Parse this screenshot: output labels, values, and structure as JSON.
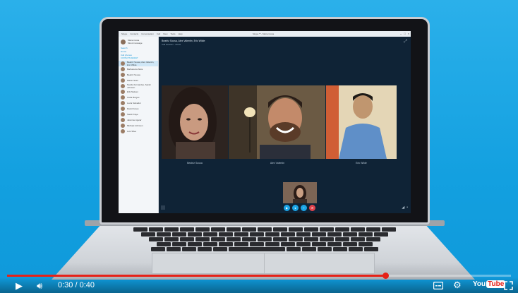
{
  "window": {
    "title": "Skype™ - Maria Costa",
    "menu": [
      "Skype",
      "Contacts",
      "Conversation",
      "Call",
      "View",
      "Tools",
      "Help"
    ]
  },
  "sidebar": {
    "profile_name": "Maria Costa",
    "profile_status": "Mood message",
    "links": [
      "Search",
      "Home",
      "Call phones"
    ],
    "section_recent": "CONTACTS",
    "section_recent_alt": "RECENT",
    "active_item": "Beatriz Sousa, Alex Valentin, Eric Wilde",
    "contacts": [
      "Barbara da Silva",
      "Beatriz Sousa",
      "Martin Stolz",
      "Nanda Fernandes, Sarah Johnson",
      "Erik Nielsen",
      "Carla Borges",
      "Lucia Salvador",
      "David Jones",
      "Sarah Kaye",
      "Jasmine Aguiar",
      "Michael Johnson",
      "Luis Silva"
    ]
  },
  "call": {
    "title": "Beatriz Sousa, Alex Valentin, Eric Wilde",
    "subtitle": "Call duration · 00:00",
    "participants": [
      {
        "name": "Beatriz Sousa"
      },
      {
        "name": "Alex Valentin"
      },
      {
        "name": "Eric Wilde"
      }
    ]
  },
  "player": {
    "time": "0:30 / 0:40",
    "progress_fraction": 0.75,
    "logo_you": "You",
    "logo_tube": "Tube",
    "progress_color": "#e62117"
  },
  "icons": [
    "play-icon",
    "volume-icon",
    "subtitles-icon",
    "settings-icon",
    "fullscreen-icon",
    "expand-icon"
  ]
}
